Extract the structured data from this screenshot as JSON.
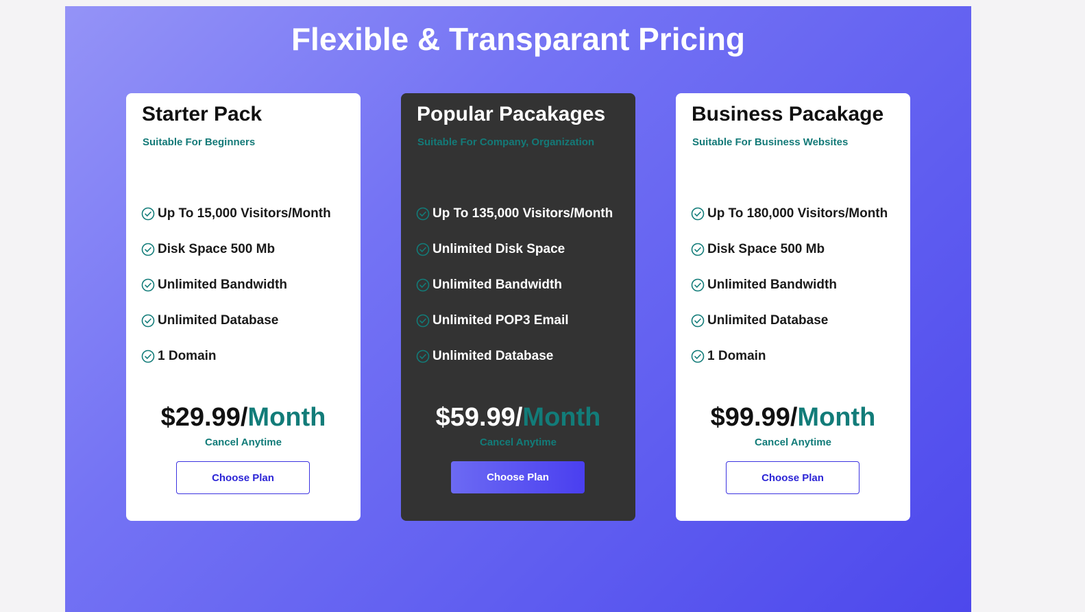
{
  "page": {
    "title": "Flexible & Transparant Pricing"
  },
  "colors": {
    "accent_teal": "#127c79",
    "button_purple": "#3b32e0",
    "dark_card": "#333333",
    "gradient_start": "#9493f7",
    "gradient_end": "#4d48ec"
  },
  "plans": [
    {
      "name": "Starter Pack",
      "subtitle": "Suitable For Beginners",
      "features": [
        "Up To 15,000 Visitors/Month",
        "Disk Space 500 Mb",
        "Unlimited Bandwidth",
        "Unlimited Database",
        "1 Domain"
      ],
      "price": "$29.99/",
      "period": "Month",
      "cancel_text": "Cancel Anytime",
      "button_label": "Choose Plan"
    },
    {
      "name": "Popular Pacakages",
      "subtitle": "Suitable For Company, Organization",
      "features": [
        "Up To 135,000 Visitors/Month",
        "Unlimited Disk Space",
        "Unlimited Bandwidth",
        "Unlimited POP3 Email",
        "Unlimited Database"
      ],
      "price": "$59.99/",
      "period": "Month",
      "cancel_text": "Cancel Anytime",
      "button_label": "Choose Plan"
    },
    {
      "name": "Business Pacakage",
      "subtitle": "Suitable For Business Websites",
      "features": [
        "Up To 180,000 Visitors/Month",
        "Disk Space 500 Mb",
        "Unlimited Bandwidth",
        "Unlimited Database",
        "1 Domain"
      ],
      "price": "$99.99/",
      "period": "Month",
      "cancel_text": "Cancel Anytime",
      "button_label": "Choose Plan"
    }
  ],
  "icons": {
    "feature_bullet": "check-circle-icon"
  }
}
